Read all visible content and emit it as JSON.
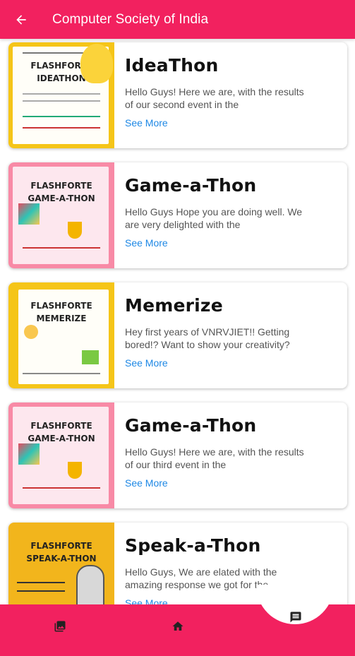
{
  "appbar": {
    "title": "Computer Society of India"
  },
  "cards": [
    {
      "title": "IdeaThon",
      "desc": "Hello Guys! Here we are, with the results of our second event in the",
      "more": "See More",
      "poster_head": "FLASHFORTE",
      "poster_sub": "IDEATHON",
      "colors": [
        "#f5c518",
        "#ffffff"
      ]
    },
    {
      "title": "Game-a-Thon",
      "desc": "Hello Guys Hope you are doing well. We are very delighted with the",
      "more": "See More",
      "poster_head": "FLASHFORTE",
      "poster_sub": "GAME-A-THON",
      "colors": [
        "#f88aa6",
        "#ffffff"
      ]
    },
    {
      "title": "Memerize",
      "desc": "Hey first years of VNRVJIET!! Getting bored!? Want to show your creativity?",
      "more": "See More",
      "poster_head": "FLASHFORTE",
      "poster_sub": "MEMERIZE",
      "colors": [
        "#f5c518",
        "#ffffff"
      ]
    },
    {
      "title": "Game-a-Thon",
      "desc": "Hello Guys! Here we are, with the results of our third event in the",
      "more": "See More",
      "poster_head": "FLASHFORTE",
      "poster_sub": "GAME-A-THON",
      "colors": [
        "#f88aa6",
        "#ffffff"
      ]
    },
    {
      "title": "Speak-a-Thon",
      "desc": "Hello Guys, We are elated with the amazing response we got for the",
      "more": "See More",
      "poster_head": "FLASHFORTE",
      "poster_sub": "SPEAK-A-THON",
      "colors": [
        "#f2b51c",
        "#f2b51c"
      ]
    }
  ],
  "theme": {
    "primary": "#f2215f",
    "link": "#1e88e5"
  },
  "bottom_nav": [
    {
      "icon": "gallery-icon"
    },
    {
      "icon": "home-icon"
    },
    {
      "icon": "message-icon"
    }
  ]
}
